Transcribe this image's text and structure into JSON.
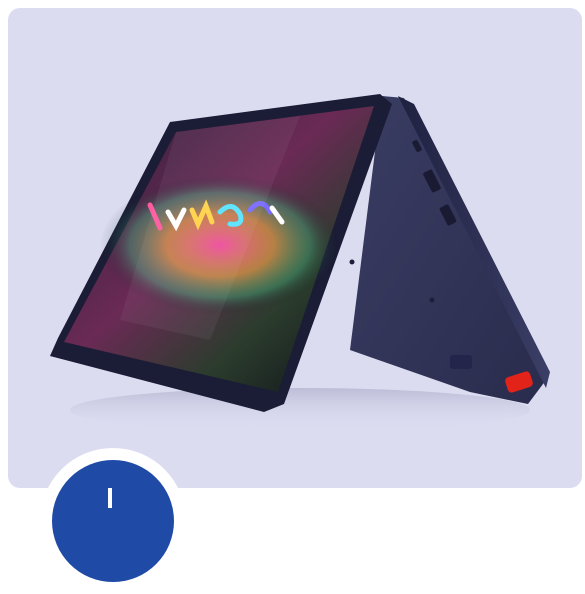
{
  "colors": {
    "card_background": "#dcdcf1",
    "device_body": "#27294a",
    "screen_dark": "#0c0d17",
    "badge_blue": "#1f4aa6",
    "accent_red": "#e2231a"
  },
  "icons": {
    "product": "convertible-laptop-tent-mode",
    "badge": "brand-logo-badge"
  }
}
